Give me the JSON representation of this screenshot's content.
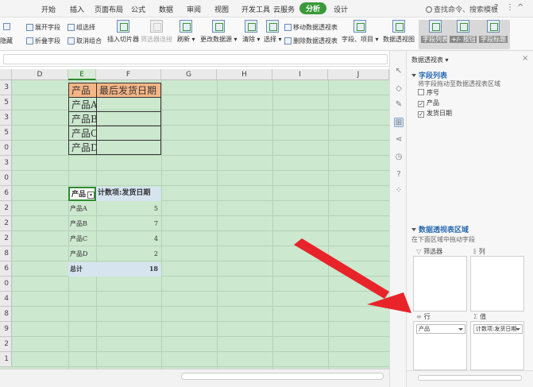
{
  "menu": {
    "items": [
      "开始",
      "插入",
      "页面布局",
      "公式",
      "数据",
      "审阅",
      "视图",
      "开发工具",
      "云服务",
      "分析",
      "设计"
    ],
    "active": "分析",
    "search": "查找命令、搜索模板",
    "help": "?"
  },
  "ribbon": {
    "hide": "隐藏",
    "expand_field": "展开字段",
    "collapse_field": "折叠字段",
    "group_select": "组选择",
    "ungroup": "取消组合",
    "insert_slicer": "插入切片器",
    "filter_connection": "筛选器连接",
    "refresh": "刷新",
    "change_source": "更改数据源",
    "clear": "清除",
    "select": "选择",
    "move_pivot": "移动数据透视表",
    "delete_pivot": "删除数据透视表",
    "fields_items": "字段、项目",
    "pivot_chart": "数据透视图",
    "field_list": "字段列表",
    "plus_minus": "+/- 按钮",
    "field_header": "字段标题"
  },
  "grid": {
    "columns": [
      "D",
      "E",
      "F",
      "G",
      "H",
      "I",
      "J"
    ],
    "selected_column": "E",
    "row_numbers": [
      "3",
      "5",
      "3",
      "5",
      "0",
      "3",
      "0",
      "6",
      "2",
      "2",
      "2",
      "8",
      "6",
      "0",
      "4",
      "8",
      "9",
      "2",
      "1"
    ],
    "source_table": {
      "headers": [
        "产品",
        "最后发货日期"
      ],
      "rows": [
        "产品A",
        "产品B",
        "产品C",
        "产品D"
      ]
    },
    "pivot": {
      "row_header": "产品",
      "value_header": "计数项:发货日期",
      "rows": [
        {
          "label": "产品A",
          "value": "5"
        },
        {
          "label": "产品B",
          "value": "7"
        },
        {
          "label": "产品C",
          "value": "4"
        },
        {
          "label": "产品D",
          "value": "2"
        }
      ],
      "total_label": "总计",
      "total_value": "18"
    }
  },
  "pivot_panel": {
    "title": "数据透视表",
    "close": "×",
    "field_list_title": "字段列表",
    "field_list_hint": "将字段拖动至数据透视表区域",
    "fields": [
      {
        "name": "序号",
        "checked": false
      },
      {
        "name": "产品",
        "checked": true
      },
      {
        "name": "发货日期",
        "checked": true
      }
    ],
    "areas_title": "数据透视表区域",
    "areas_hint": "在下面区域中拖动字段",
    "filter_label": "筛选器",
    "column_label": "列",
    "row_label": "行",
    "value_label": "值",
    "row_field": "产品",
    "value_field": "计数项:发货日期"
  }
}
